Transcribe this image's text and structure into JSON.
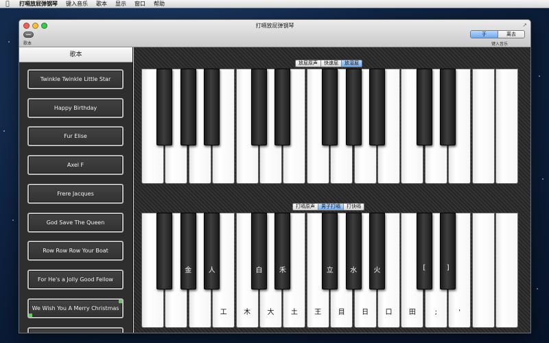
{
  "menubar": {
    "app_name": "打嗝放屁弹钢琴",
    "items": [
      "键入音乐",
      "歌本",
      "显示",
      "窗口",
      "帮助"
    ]
  },
  "window": {
    "title": "打嗝放屁弹钢琴",
    "songbook_label": "歌本",
    "keyin_label": "键入音乐",
    "segment": {
      "options": [
        "于",
        "离去"
      ],
      "selected": 0
    }
  },
  "sidebar": {
    "header": "歌本",
    "songs": [
      "Twinkle Twinkle Little Star",
      "Happy Birthday",
      "Fur Elise",
      "Axel F",
      "Frere Jacques",
      "God Save The Queen",
      "Row Row Row Your Boat",
      "For He's a Jolly Good Fellow",
      "We Wish You A Merry Christmas"
    ],
    "selected": 8
  },
  "keyboard_top": {
    "sound_options": [
      "放屁原声",
      "快速屁",
      "放湿屁"
    ],
    "selected": 2,
    "white_key_count": 16,
    "black_keys_after_white": [
      1,
      2,
      3,
      5,
      6,
      8,
      9,
      10,
      12,
      13
    ]
  },
  "keyboard_bottom": {
    "sound_options": [
      "打嗝原声",
      "男子打嗝",
      "打快嗝"
    ],
    "selected": 1,
    "white_key_count": 16,
    "black_keys_after_white": [
      1,
      2,
      3,
      5,
      6,
      8,
      9,
      10,
      12,
      13
    ],
    "white_labels": [
      "",
      "",
      "",
      "工",
      "木",
      "大",
      "土",
      "王",
      "目",
      "日",
      "口",
      "田",
      ";",
      "'",
      "",
      ""
    ],
    "black_labels": [
      "",
      "金",
      "人",
      "白",
      "禾",
      "立",
      "水",
      "火",
      "[",
      "]"
    ]
  },
  "colors": {
    "accent": "#74abee",
    "window_bg": "#dcdcdc",
    "sidebar_bg": "#2e2e2e"
  }
}
